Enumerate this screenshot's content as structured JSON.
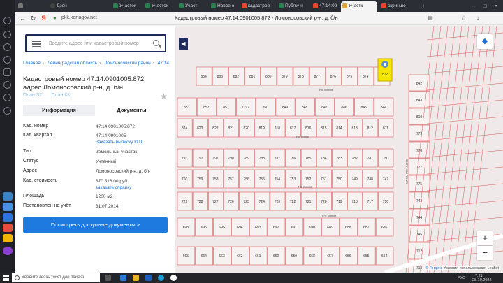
{
  "browser": {
    "tabs": [
      {
        "label": "",
        "active": false
      },
      {
        "label": "Дзен",
        "active": false
      },
      {
        "label": "Участок",
        "active": false
      },
      {
        "label": "Участок",
        "active": false
      },
      {
        "label": "Участ",
        "active": false
      },
      {
        "label": "Новое о",
        "active": false
      },
      {
        "label": "кадастров",
        "active": false
      },
      {
        "label": "Публичн",
        "active": false
      },
      {
        "label": "47:14:09",
        "active": false
      },
      {
        "label": "Участк",
        "active": true
      },
      {
        "label": "скриншо",
        "active": false
      }
    ],
    "url": "pkk.kartagov.net",
    "page_title": "Кадастровый номер 47:14:0901005:872 - Ломоносовский р-н, д. б/н"
  },
  "panel": {
    "search_placeholder": "Введите адрес или кадастровый номер",
    "breadcrumbs": [
      "Главная",
      "Ленинградская область",
      "Ломоносовский район",
      "47:14"
    ],
    "heading": "Кадастровый номер 47:14:0901005:872, адрес Ломоносовский р-н, д. б/н",
    "plan_links": [
      "План ЗУ",
      "План КК"
    ],
    "tabs": [
      "Информация",
      "Документы"
    ],
    "props": [
      {
        "key": "Кад. номер",
        "value": "47:14:0901005:872",
        "link": ""
      },
      {
        "key": "Кад. квартал",
        "value": "47:14:0901005",
        "link": "Заказать выписку КПТ"
      },
      {
        "key": "Тип",
        "value": "Земельный участок",
        "link": ""
      },
      {
        "key": "Статус",
        "value": "Учтенный",
        "link": ""
      },
      {
        "key": "Адрес",
        "value": "Ломоносовский р-н, д. б/н",
        "link": ""
      },
      {
        "key": "Кад. стоимость",
        "value": "870 516.00 руб.",
        "link": "заказать справку"
      },
      {
        "key": "Площадь",
        "value": "1200 м2",
        "link": ""
      },
      {
        "key": "Постановлен на учёт",
        "value": "31.07.2014",
        "link": ""
      }
    ],
    "docs_button": "Посмотреть доступные документы >"
  },
  "map": {
    "zoom_in": "+",
    "zoom_out": "−",
    "attribution_yandex": "© Яндекс",
    "attribution_terms": "Условия использования",
    "leaflet": "Leaflet",
    "street_labels": [
      "9-я линия",
      "8-я линия",
      "7-я линия",
      "6-я линия",
      "Восточная линия"
    ],
    "selected_parcel": "872",
    "parcel_rows": [
      [
        "884",
        "883",
        "882",
        "881",
        "880",
        "879",
        "878",
        "877",
        "876",
        "875",
        "874",
        "873"
      ],
      [
        "853",
        "852",
        "851",
        "1197",
        "850",
        "849",
        "848",
        "847",
        "846",
        "845",
        "844"
      ],
      [
        "824",
        "823",
        "822",
        "821",
        "820",
        "819",
        "818",
        "817",
        "816",
        "815",
        "814",
        "813",
        "812",
        "811"
      ],
      [
        "793",
        "792",
        "791",
        "790",
        "789",
        "788",
        "787",
        "786",
        "785",
        "784",
        "783",
        "782",
        "781",
        "780"
      ],
      [
        "760",
        "759",
        "758",
        "757",
        "756",
        "755",
        "754",
        "753",
        "752",
        "751",
        "750",
        "749",
        "748",
        "747"
      ],
      [
        "729",
        "728",
        "727",
        "726",
        "725",
        "724",
        "723",
        "722",
        "721",
        "720",
        "719",
        "718",
        "717",
        "716"
      ],
      [
        "698",
        "696",
        "695",
        "694",
        "693",
        "692",
        "691",
        "690",
        "689",
        "688",
        "687",
        "686"
      ],
      [
        "665",
        "664",
        "663",
        "662",
        "661",
        "660",
        "659",
        "658",
        "657",
        "656",
        "655",
        "654"
      ]
    ],
    "right_column": [
      "842",
      "843",
      "810",
      "779",
      "778",
      "777",
      "775",
      "743",
      "744",
      "745",
      "712",
      "713"
    ]
  },
  "taskbar": {
    "search_placeholder": "Введите здесь текст для поиска",
    "lang": "РУС",
    "time": "7:21",
    "date": "28.10.2022"
  },
  "colors": {
    "search_border": "#1d2a5a",
    "primary_button": "#1f7ae0",
    "link": "#1e6fd0",
    "parcel_selected": "#f5e600",
    "parcel_line": "#d85a5a"
  }
}
